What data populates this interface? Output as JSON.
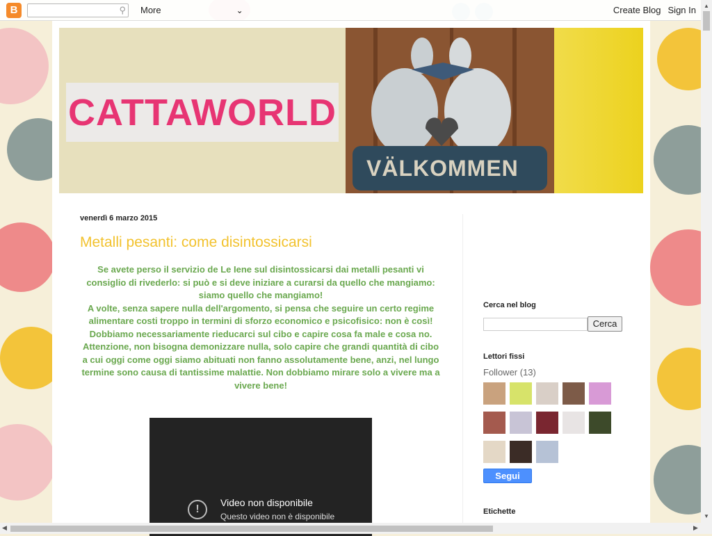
{
  "navbar": {
    "more_label": "More",
    "create_blog": "Create Blog",
    "sign_in": "Sign In",
    "logo_glyph": "B",
    "search_icon": "search-icon",
    "chevron": "chevron-down-icon"
  },
  "header": {
    "blog_title": "CATTAWORLD",
    "sign_text": "VÄLKOMMEN"
  },
  "post": {
    "date": "venerdì 6 marzo 2015",
    "title": "Metalli pesanti: come disintossicarsi",
    "paragraphs": [
      "Se avete perso il servizio de Le Iene sul disintossicarsi dai metalli pesanti vi consiglio di rivederlo: si può e si deve iniziare a curarsi da quello che mangiamo: siamo quello che mangiamo!",
      "A volte, senza sapere nulla dell'argomento, si pensa che seguire un certo regime alimentare costi troppo in termini di sforzo economico e psicofisico: non è così! Dobbiamo necessariamente rieducarci sul cibo e capire cosa fa male e cosa no. Attenzione, non bisogna demonizzare nulla, solo capire che grandi quantità di cibo a cui oggi come oggi siamo abituati non fanno assolutamente bene, anzi, nel lungo termine sono causa di tantissime malattie. Non dobbiamo mirare solo a vivere ma a vivere bene!"
    ],
    "video": {
      "title": "Video non disponibile",
      "subtitle": "Questo video non è disponibile"
    }
  },
  "sidebar": {
    "search_heading": "Cerca nel blog",
    "search_button": "Cerca",
    "followers_heading": "Lettori fissi",
    "followers_label": "Follower (13)",
    "follow_button": "Segui",
    "labels_heading": "Etichette"
  },
  "colors": {
    "title_pink": "#e73573",
    "post_title": "#f2c22e",
    "post_text": "#6aa84f",
    "header_yellow": "#ecd21e"
  }
}
